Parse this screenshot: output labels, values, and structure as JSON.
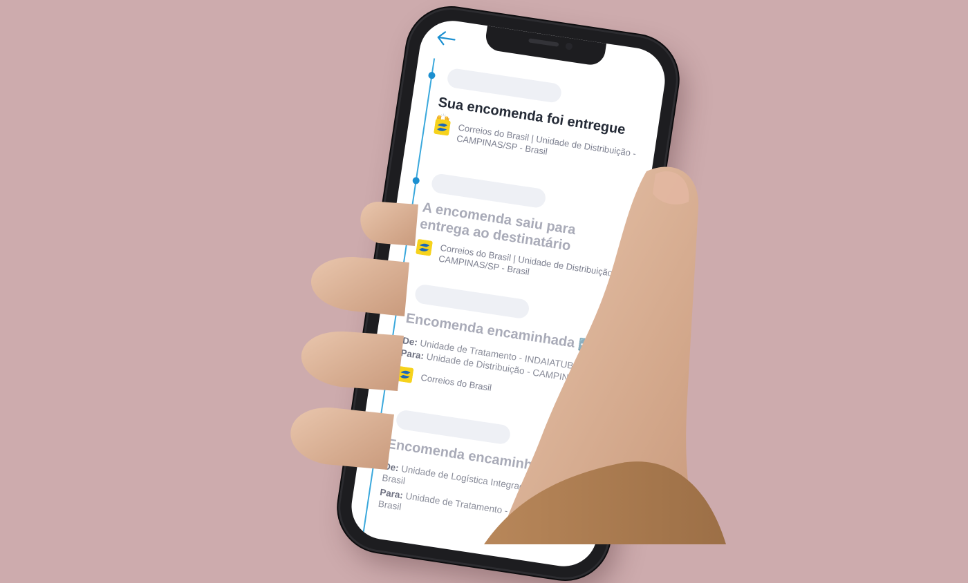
{
  "colors": {
    "background": "#cdabad",
    "accent": "#1b8fd0",
    "timeline": "#3aa8dc",
    "title_active": "#242a36",
    "title_muted": "#a9abb8",
    "text_muted": "#7d8090",
    "pill": "#eef0f5"
  },
  "header": {
    "back_icon": "arrow-left-icon"
  },
  "events": [
    {
      "title": "Sua encomenda foi entregue",
      "emoji": "🙌",
      "carrier": "Correios do Brasil | Unidade de Distribuição - CAMPINAS/SP - Brasil"
    },
    {
      "title": "A encomenda saiu para entrega ao destinatário",
      "carrier": "Correios do Brasil | Unidade de Distribuição - CAMPINAS/SP - Brasil"
    },
    {
      "title": "Encomenda encaminhada",
      "emoji": "➡️🚚📦",
      "from_label": "De:",
      "from": "Unidade de Tratamento - INDAIATUBA/SP - B",
      "to_label": "Para:",
      "to": "Unidade de Distribuição - CAMPINAS/SP - B",
      "carrier": "Correios do Brasil"
    },
    {
      "title": "Encomenda encaminhada",
      "emoji": "➡️",
      "from_label": "De:",
      "from": "Unidade de Logística Integrada - CURIT",
      "from_cont": "Brasil",
      "to_label": "Para:",
      "to": "Unidade de Tratamento - INDAIATUB",
      "to_cont": "Brasil"
    }
  ]
}
